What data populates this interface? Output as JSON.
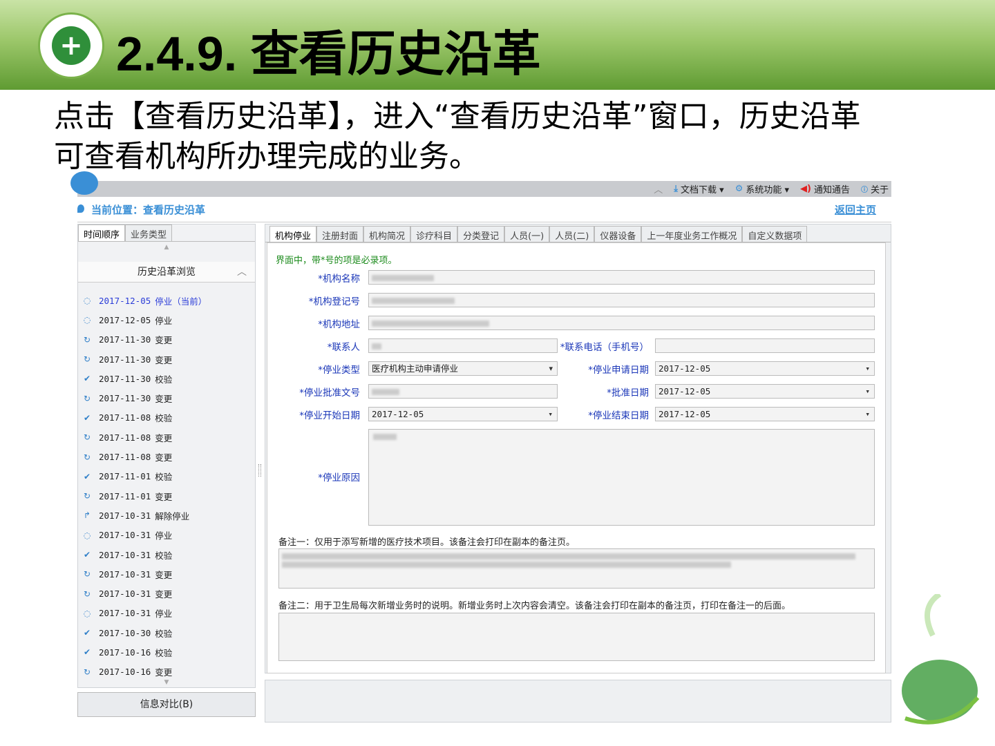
{
  "slide": {
    "title": "2.4.9. 查看历史沿革",
    "desc_line1": "点击【查看历史沿革】，进入“查看历史沿革”窗口，历史沿革",
    "desc_line2": "可查看机构所办理完成的业务。"
  },
  "toolbar": {
    "items": [
      {
        "icon": "download-icon",
        "label": "文档下载 ▾"
      },
      {
        "icon": "gear-icon",
        "label": "系统功能 ▾"
      },
      {
        "icon": "speaker-icon",
        "label": "通知通告"
      },
      {
        "icon": "info-icon",
        "label": "关于"
      }
    ]
  },
  "location": {
    "text": "当前位置：查看历史沿革",
    "home_link": "返回主页"
  },
  "left": {
    "tabs": [
      "时间顺序",
      "业务类型"
    ],
    "header": "历史沿革浏览",
    "compare_button": "信息对比(B)",
    "items": [
      {
        "date": "2017-12-05",
        "type": "停业（当前）",
        "icon": "stop"
      },
      {
        "date": "2017-12-05",
        "type": "停业",
        "icon": "stop"
      },
      {
        "date": "2017-11-30",
        "type": "变更",
        "icon": "change"
      },
      {
        "date": "2017-11-30",
        "type": "变更",
        "icon": "change"
      },
      {
        "date": "2017-11-30",
        "type": "校验",
        "icon": "check"
      },
      {
        "date": "2017-11-30",
        "type": "变更",
        "icon": "change"
      },
      {
        "date": "2017-11-08",
        "type": "校验",
        "icon": "check"
      },
      {
        "date": "2017-11-08",
        "type": "变更",
        "icon": "change"
      },
      {
        "date": "2017-11-08",
        "type": "变更",
        "icon": "change"
      },
      {
        "date": "2017-11-01",
        "type": "校验",
        "icon": "check"
      },
      {
        "date": "2017-11-01",
        "type": "变更",
        "icon": "change"
      },
      {
        "date": "2017-10-31",
        "type": "解除停业",
        "icon": "resume"
      },
      {
        "date": "2017-10-31",
        "type": "停业",
        "icon": "stop"
      },
      {
        "date": "2017-10-31",
        "type": "校验",
        "icon": "check"
      },
      {
        "date": "2017-10-31",
        "type": "变更",
        "icon": "change"
      },
      {
        "date": "2017-10-31",
        "type": "变更",
        "icon": "change"
      },
      {
        "date": "2017-10-31",
        "type": "停业",
        "icon": "stop"
      },
      {
        "date": "2017-10-30",
        "type": "校验",
        "icon": "check"
      },
      {
        "date": "2017-10-16",
        "type": "校验",
        "icon": "check"
      },
      {
        "date": "2017-10-16",
        "type": "变更",
        "icon": "change"
      }
    ]
  },
  "right": {
    "tabs": [
      "机构停业",
      "注册封面",
      "机构简况",
      "诊疗科目",
      "分类登记",
      "人员(一)",
      "人员(二)",
      "仪器设备",
      "上一年度业务工作概况",
      "自定义数据项"
    ],
    "note": "界面中，带*号的项是必录项。",
    "form": {
      "name_label": "*机构名称",
      "reg_label": "*机构登记号",
      "addr_label": "*机构地址",
      "contact_label": "*联系人",
      "phone_label": "*联系电话（手机号）",
      "stop_type_label": "*停业类型",
      "stop_type_value": "医疗机构主动申请停业",
      "apply_date_label": "*停业申请日期",
      "apply_date": "2017-12-05",
      "approval_no_label": "*停业批准文号",
      "approve_date_label": "*批准日期",
      "approve_date": "2017-12-05",
      "start_label": "*停业开始日期",
      "start_date": "2017-12-05",
      "end_label": "*停业结束日期",
      "end_date": "2017-12-05",
      "reason_label": "*停业原因",
      "remark1_label": "备注一：仅用于添写新增的医疗技术项目。该备注会打印在副本的备注页。",
      "remark2_label": "备注二：用于卫生局每次新增业务时的说明。新增业务时上次内容会清空。该备注会打印在副本的备注页，打印在备注一的后面。"
    }
  }
}
